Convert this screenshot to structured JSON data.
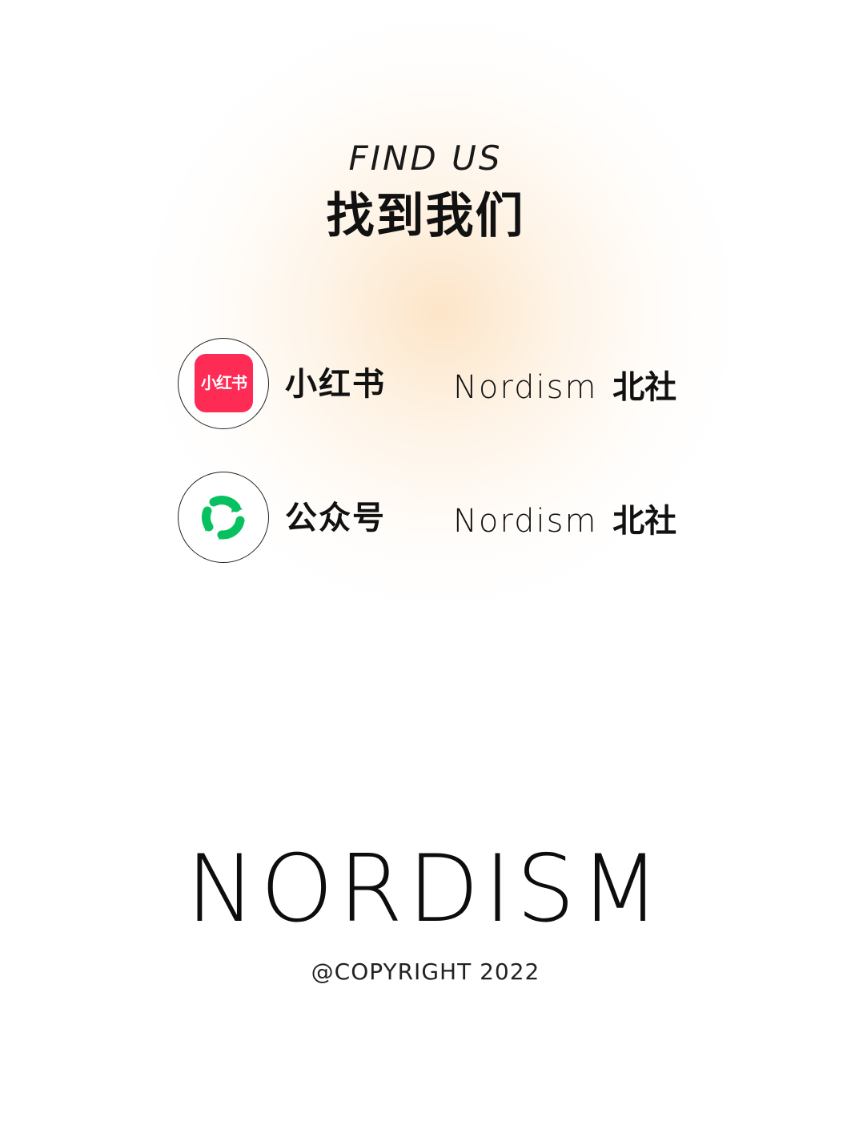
{
  "header": {
    "title_en": "FIND US",
    "title_zh": "找到我们"
  },
  "socials": [
    {
      "logo_text": "小红书",
      "platform": "小红书",
      "handle_latin": "Nordism",
      "handle_cjk": "北社",
      "icon": "xiaohongshu-logo-icon",
      "color": "#fe2c55"
    },
    {
      "platform": "公众号",
      "handle_latin": "Nordism",
      "handle_cjk": "北社",
      "icon": "wechat-official-account-icon",
      "color": "#07c160"
    }
  ],
  "brand": {
    "name": "NORDISM",
    "copyright": "@COPYRIGHT 2022"
  },
  "colors": {
    "background": "#ffffff",
    "glow": "#fce0be",
    "text": "#111111"
  }
}
